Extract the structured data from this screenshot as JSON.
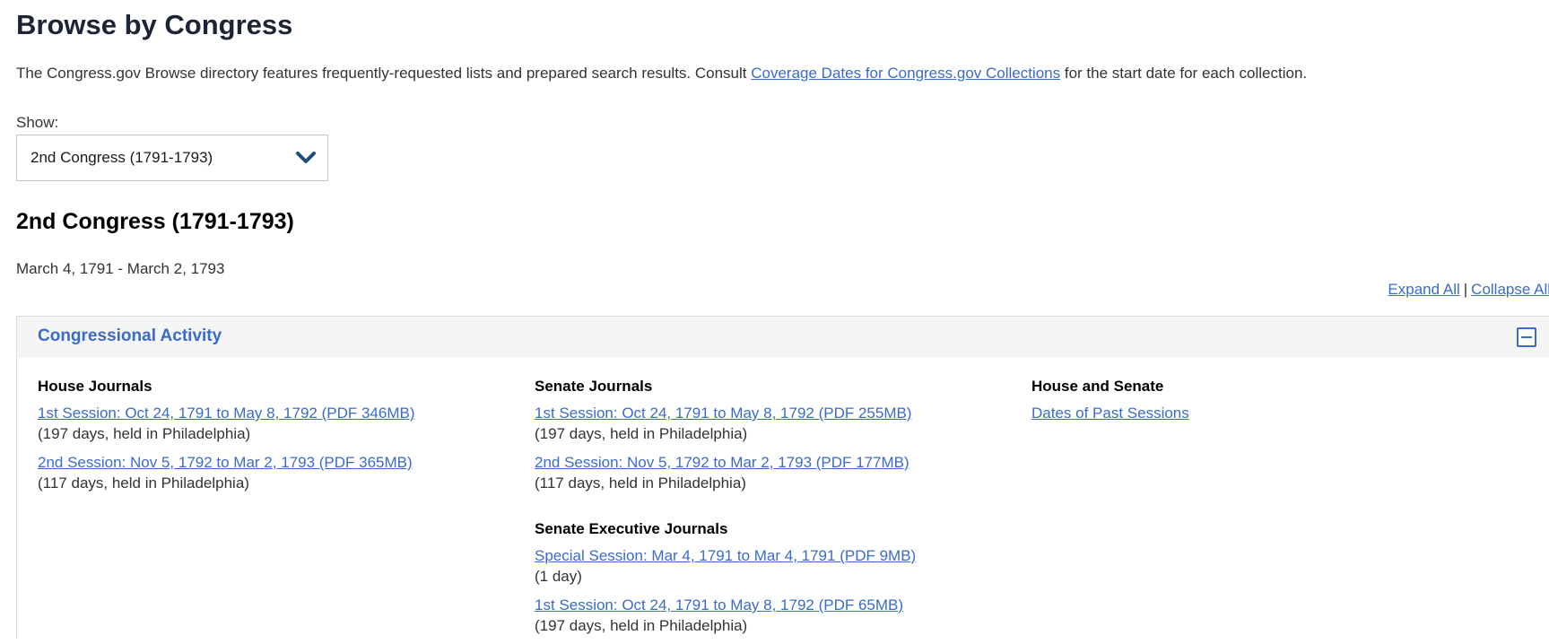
{
  "page": {
    "title": "Browse by Congress",
    "intro_before": "The Congress.gov Browse directory features frequently-requested lists and prepared search results. Consult ",
    "intro_link": "Coverage Dates for Congress.gov Collections",
    "intro_after": " for the start date for each collection."
  },
  "selector": {
    "label": "Show:",
    "selected": "2nd Congress (1791-1793)",
    "icon": "chevron-down-icon"
  },
  "congress": {
    "heading": "2nd Congress (1791-1793)",
    "date_range": "March 4, 1791 - March 2, 1793"
  },
  "controls": {
    "expand_all": "Expand All",
    "separator": "|",
    "collapse_all": "Collapse All"
  },
  "panel": {
    "title": "Congressional Activity",
    "toggle_icon": "minus-square-icon",
    "columns": {
      "house": {
        "heading": "House Journals",
        "entries": [
          {
            "link": "1st Session: Oct 24, 1791 to May 8, 1792 (PDF 346MB)",
            "note": "(197 days, held in Philadelphia)"
          },
          {
            "link": "2nd Session: Nov 5, 1792 to Mar 2, 1793 (PDF 365MB)",
            "note": "(117 days, held in Philadelphia)"
          }
        ]
      },
      "senate": {
        "heading": "Senate Journals",
        "entries": [
          {
            "link": "1st Session: Oct 24, 1791 to May 8, 1792 (PDF 255MB)",
            "note": "(197 days, held in Philadelphia)"
          },
          {
            "link": "2nd Session: Nov 5, 1792 to Mar 2, 1793 (PDF 177MB)",
            "note": "(117 days, held in Philadelphia)"
          }
        ]
      },
      "senate_exec": {
        "heading": "Senate Executive Journals",
        "entries": [
          {
            "link": "Special Session: Mar 4, 1791 to Mar 4, 1791 (PDF 9MB)",
            "note": "(1 day)"
          },
          {
            "link": "1st Session: Oct 24, 1791 to May 8, 1792 (PDF 65MB)",
            "note": "(197 days, held in Philadelphia)"
          }
        ]
      },
      "house_senate": {
        "heading": "House and Senate",
        "entries": [
          {
            "link": "Dates of Past Sessions"
          }
        ]
      }
    }
  },
  "colors": {
    "link": "#3b6bc9",
    "title": "#1b2535",
    "panel_header_bg": "#f5f5f5",
    "chevron": "#1f4e79"
  }
}
